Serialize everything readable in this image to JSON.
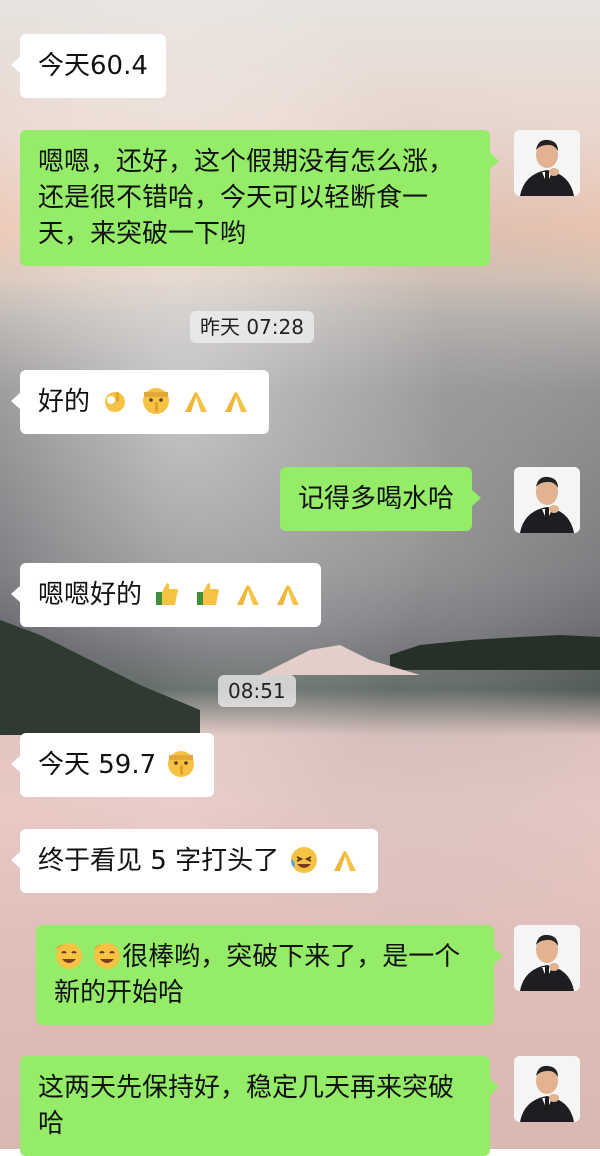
{
  "messages": [
    {
      "side": "left",
      "text": "今天60.4",
      "emojis": []
    },
    {
      "side": "right",
      "text": "嗯嗯，还好，这个假期没有怎么涨，还是很不错哈，今天可以轻断食一天，来突破一下哟",
      "emojis": []
    },
    {
      "side": "time",
      "text": "昨天 07:28"
    },
    {
      "side": "left",
      "text": "好的",
      "emojis": [
        "ok-hand-icon",
        "shushing-face-icon",
        "pray-icon",
        "pray-icon"
      ]
    },
    {
      "side": "right",
      "text": "记得多喝水哈",
      "emojis": []
    },
    {
      "side": "left",
      "text": "嗯嗯好的",
      "emojis": [
        "thumbs-up-icon",
        "thumbs-up-icon",
        "pray-icon",
        "pray-icon"
      ]
    },
    {
      "side": "time",
      "text": "08:51"
    },
    {
      "side": "left",
      "text": "今天 59.7",
      "emojis": [
        "shushing-face-icon"
      ]
    },
    {
      "side": "left",
      "text": "终于看见 5 字打头了",
      "emojis": [
        "crying-laughing-icon",
        "pray-icon"
      ]
    },
    {
      "side": "right",
      "text": "很棒哟，突破下来了，是一个新的开始哈",
      "emojis": [
        "lol-face-icon",
        "lol-face-icon"
      ]
    },
    {
      "side": "right",
      "text": "这两天先保持好，稳定几天再来突破哈",
      "emojis": []
    }
  ],
  "colors": {
    "sent": "#95ec69",
    "received": "#ffffff"
  }
}
